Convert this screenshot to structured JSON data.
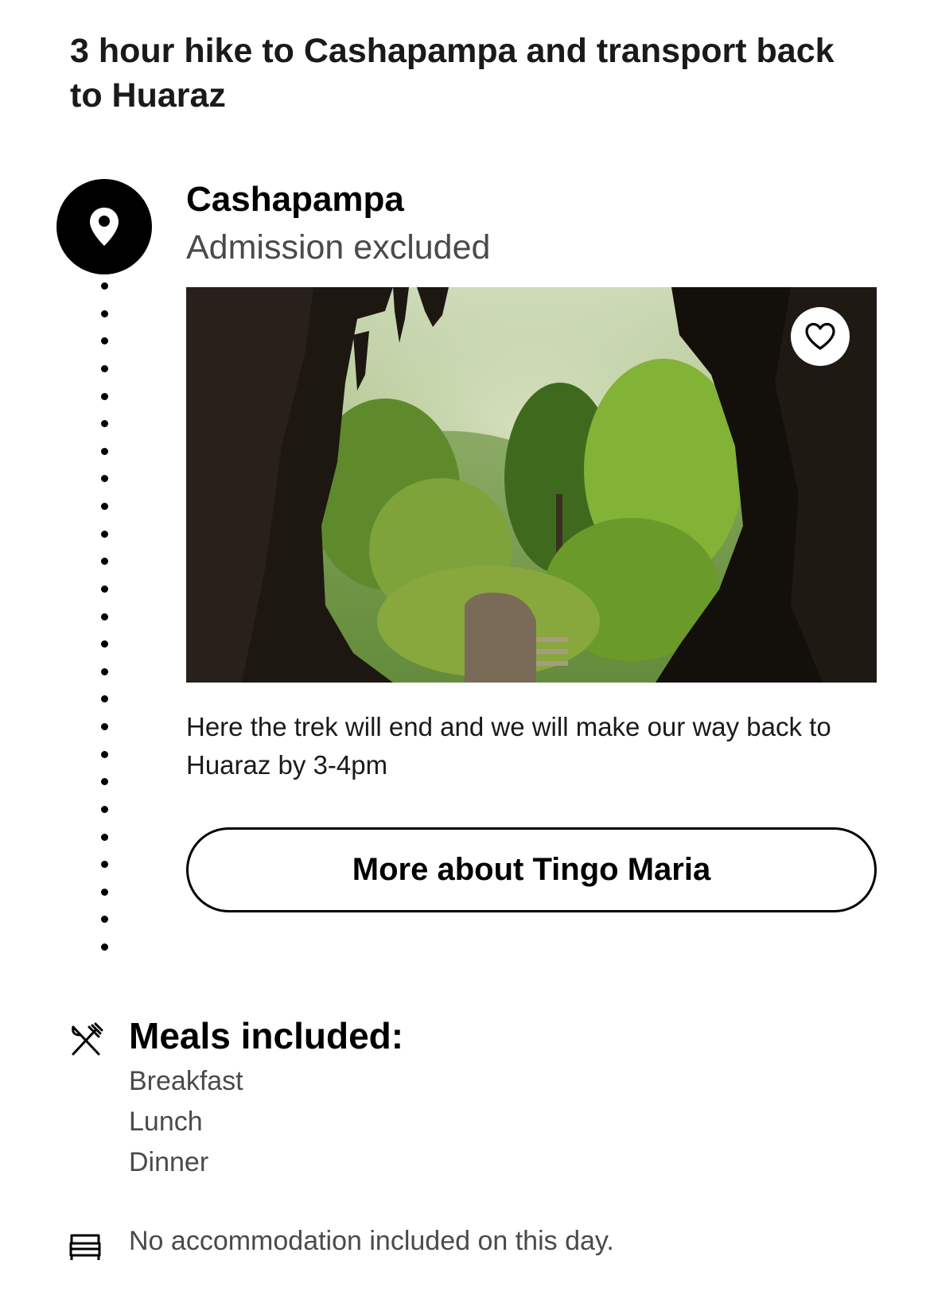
{
  "day": {
    "title": "3 hour hike to Cashapampa and transport back to Huaraz"
  },
  "stop": {
    "marker_icon": "location-pin-icon",
    "name": "Cashapampa",
    "admission": "Admission excluded",
    "photo": {
      "subject": "view out of a cave mouth onto green jungle trees and stone steps",
      "save_icon": "heart-icon"
    },
    "description": "Here the trek will end and we will make our way back to Huaraz by 3-4pm",
    "more_button_label": "More about Tingo Maria"
  },
  "meals": {
    "icon": "utensils-icon",
    "heading": "Meals included:",
    "items": [
      "Breakfast",
      "Lunch",
      "Dinner"
    ]
  },
  "accommodation": {
    "icon": "bed-icon",
    "text": "No accommodation included on this day."
  },
  "colors": {
    "primary_text": "#000000",
    "secondary_text": "#4a4a4a",
    "background": "#ffffff"
  }
}
